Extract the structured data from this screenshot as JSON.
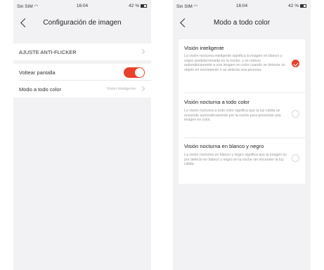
{
  "left_screen": {
    "status": {
      "carrier": "Sin SIM",
      "time": "16:04",
      "battery": "42 %"
    },
    "title": "Configuración de imagen",
    "rows": [
      {
        "label": "AJUSTE ANTI-FLICKER"
      },
      {
        "label": "Voltear pantalla",
        "toggle_on": true
      },
      {
        "label": "Modo a todo color",
        "value": "Visión inteligente"
      }
    ]
  },
  "right_screen": {
    "status": {
      "carrier": "Sin SIM",
      "time": "16:04",
      "battery": "42 %"
    },
    "title": "Modo a todo color",
    "options": [
      {
        "title": "Visión inteligente",
        "description": "La visión nocturna inteligente significa la imagen en blanco y negro predeterminada en la noche, y se reduce automáticamente a una imagen en color cuando se detecta un objeto en movimiento o se detecta una persona.",
        "selected": true
      },
      {
        "title": "Visión nocturna a todo color",
        "description": "La visión nocturna a todo color significa que la luz cálida se enciende automáticamente por la noche para presentar una imagen en color.",
        "selected": false
      },
      {
        "title": "Visión nocturna en blanco y negro",
        "description": "La visión nocturna en blanco y negro significa que la imagen es por defecto en blanco y negro en la noche sin encender la luz cálida.",
        "selected": false
      }
    ]
  },
  "colors": {
    "accent": "#e8412c",
    "background": "#f2f2f4"
  }
}
